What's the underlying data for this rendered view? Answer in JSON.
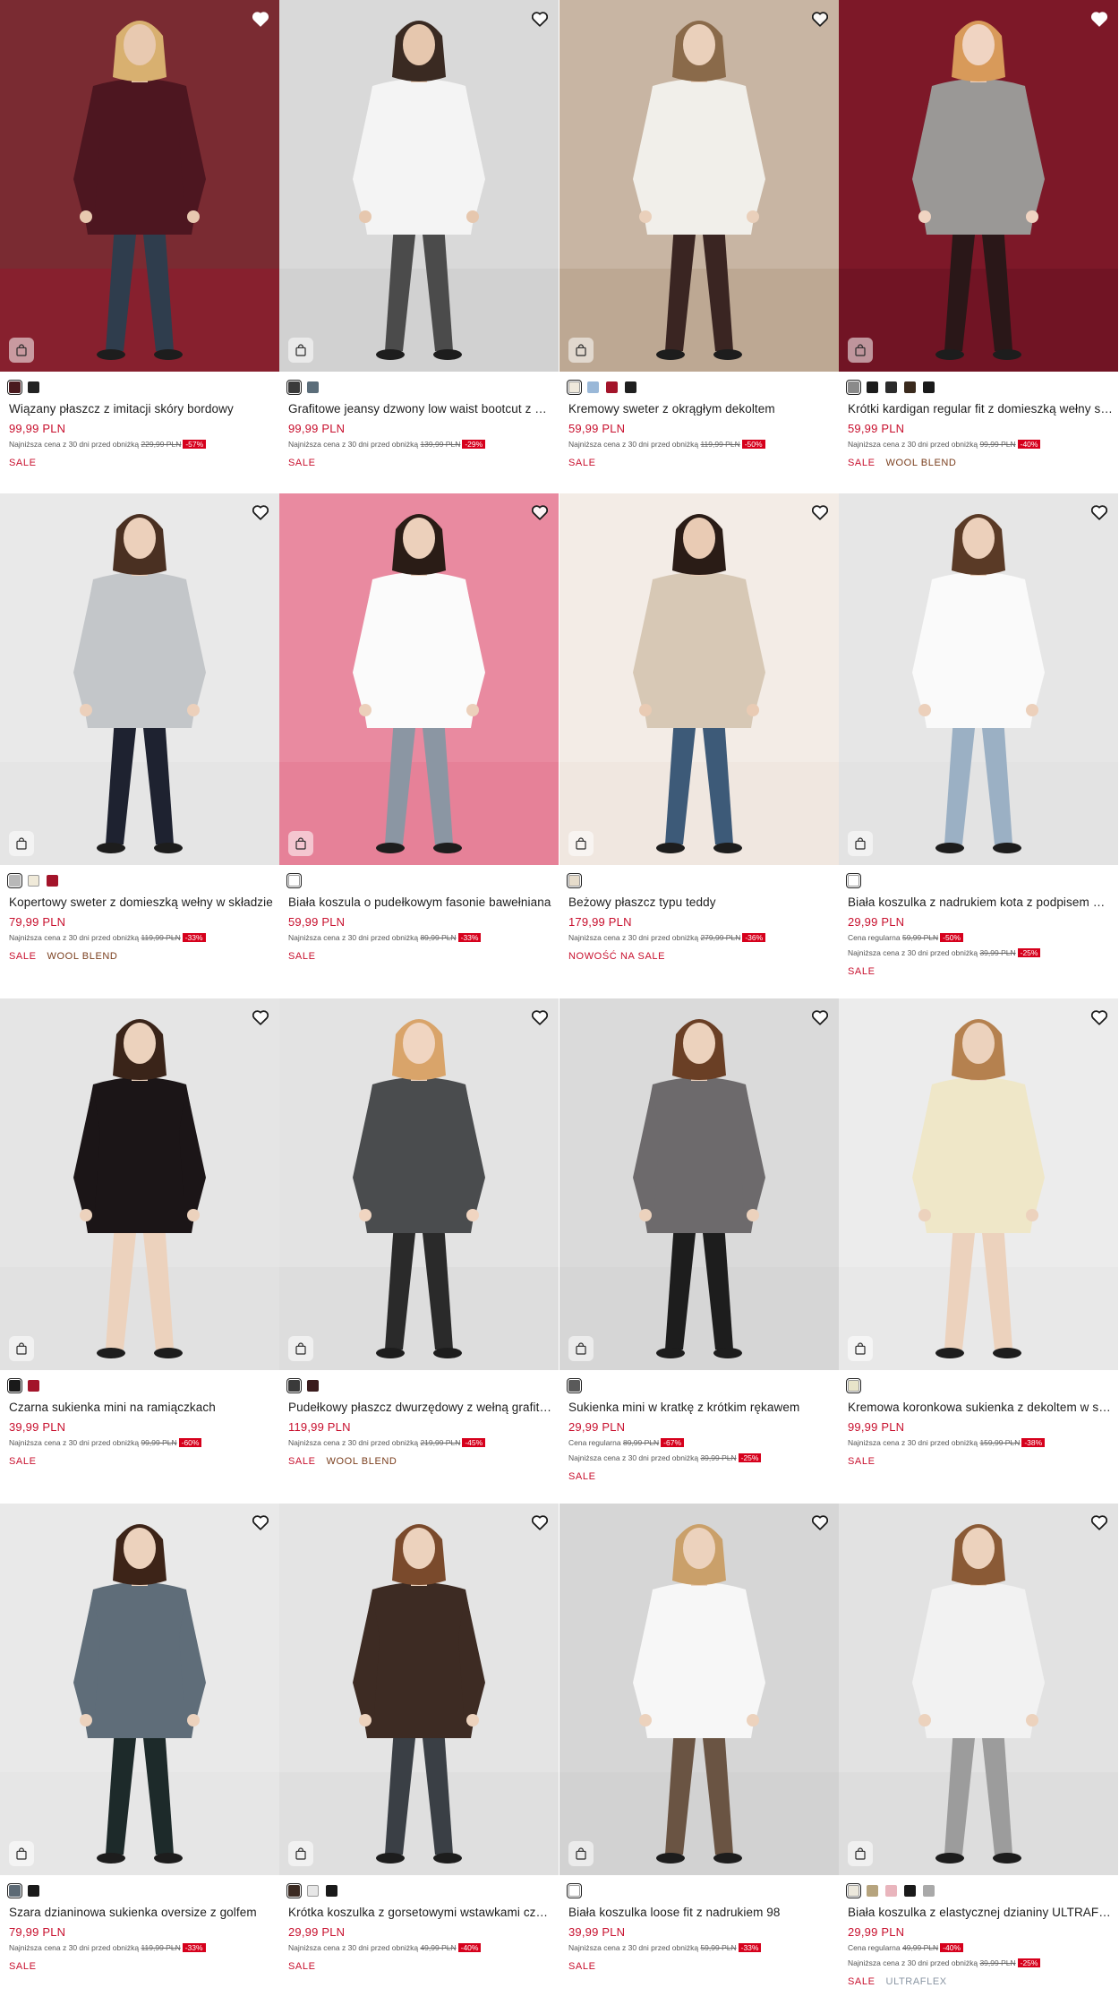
{
  "colors": {
    "price": "#c8102e",
    "discount_badge": "#d6001c",
    "tag_secondary": "#7a3e1d"
  },
  "icons": {
    "favorite": "heart-icon",
    "add_to_bag": "shopping-bag-icon"
  },
  "products": [
    {
      "title": "Wiązany płaszcz z imitacji skóry bordowy",
      "price": "99,99 PLN",
      "lines": [
        {
          "text": "Najniższa cena z 30 dni przed obniżką",
          "old": "229,99 PLN",
          "disc": "-57%"
        }
      ],
      "tags": [
        "SALE"
      ],
      "swatches": [
        "#4a1a1e",
        "#222222"
      ],
      "selected": 0,
      "heart_filled": true,
      "scene": {
        "bg1": "#7a2b32",
        "bg2": "#a14a53",
        "floor": "#8a1f2e",
        "garment": "#4d1620",
        "skin": "#e8c9b0",
        "hair": "#d8b070",
        "legs": "#2f3d4d"
      }
    },
    {
      "title": "Grafitowe jeansy dzwony low waist bootcut z wysokim stanem",
      "price": "99,99 PLN",
      "lines": [
        {
          "text": "Najniższa cena z 30 dni przed obniżką",
          "old": "139,99 PLN",
          "disc": "-29%"
        }
      ],
      "tags": [
        "SALE"
      ],
      "swatches": [
        "#3a3a3a",
        "#5b6d7a"
      ],
      "selected": 0,
      "heart_filled": false,
      "scene": {
        "bg1": "#d9d9d9",
        "bg2": "#c9c9c9",
        "floor": "#cfcfcf",
        "garment": "#f4f4f4",
        "skin": "#e6c7ae",
        "hair": "#3a2a22",
        "legs": "#4b4b4b"
      }
    },
    {
      "title": "Kremowy sweter z okrągłym dekoltem",
      "price": "59,99 PLN",
      "lines": [
        {
          "text": "Najniższa cena z 30 dni przed obniżką",
          "old": "119,99 PLN",
          "disc": "-50%"
        }
      ],
      "tags": [
        "SALE"
      ],
      "swatches": [
        "#efe9dc",
        "#9ab8d8",
        "#a3142a",
        "#1f1f1f"
      ],
      "selected": 0,
      "heart_filled": false,
      "scene": {
        "bg1": "#c8b5a3",
        "bg2": "#b39d89",
        "floor": "#bba690",
        "garment": "#f1efea",
        "skin": "#ead0bb",
        "hair": "#8a6a4a",
        "legs": "#3a2522"
      }
    },
    {
      "title": "Krótki kardigan regular fit z domieszką wełny szary",
      "price": "59,99 PLN",
      "lines": [
        {
          "text": "Najniższa cena z 30 dni przed obniżką",
          "old": "99,99 PLN",
          "disc": "-40%"
        }
      ],
      "tags": [
        "SALE",
        "WOOL BLEND"
      ],
      "swatches": [
        "#8a8a8a",
        "#1c1c1c",
        "#2b2b2b",
        "#3a2a1d",
        "#1a1a1a"
      ],
      "selected": 0,
      "heart_filled": true,
      "scene": {
        "bg1": "#7d1828",
        "bg2": "#8f2233",
        "floor": "#6e1423",
        "garment": "#9a9896",
        "skin": "#f0d4c2",
        "hair": "#d89a5a",
        "legs": "#2a1718"
      }
    },
    {
      "title": "Kopertowy sweter z domieszką wełny w składzie",
      "price": "79,99 PLN",
      "lines": [
        {
          "text": "Najniższa cena z 30 dni przed obniżką",
          "old": "119,99 PLN",
          "disc": "-33%"
        }
      ],
      "tags": [
        "SALE",
        "WOOL BLEND"
      ],
      "swatches": [
        "#b8b8b8",
        "#f0ead9",
        "#a3142a"
      ],
      "selected": 0,
      "heart_filled": false,
      "scene": {
        "bg1": "#e9e9e9",
        "bg2": "#dedede",
        "floor": "#e4e4e4",
        "garment": "#c3c6c9",
        "skin": "#ecd0bb",
        "hair": "#4a3022",
        "legs": "#1e2230"
      }
    },
    {
      "title": "Biała koszula o pudełkowym fasonie bawełniana",
      "price": "59,99 PLN",
      "lines": [
        {
          "text": "Najniższa cena z 30 dni przed obniżką",
          "old": "89,99 PLN",
          "disc": "-33%"
        }
      ],
      "tags": [
        "SALE"
      ],
      "swatches": [
        "#ffffff"
      ],
      "selected": 0,
      "heart_filled": false,
      "scene": {
        "bg1": "#e98aa0",
        "bg2": "#dc6f89",
        "floor": "#e57f97",
        "garment": "#fbfbfb",
        "skin": "#ecd0bb",
        "hair": "#2a1c16",
        "legs": "#8b96a3"
      }
    },
    {
      "title": "Beżowy płaszcz typu teddy",
      "price": "179,99 PLN",
      "lines": [
        {
          "text": "Najniższa cena z 30 dni przed obniżką",
          "old": "279,99 PLN",
          "disc": "-36%"
        }
      ],
      "tags": [
        "NOWOŚĆ NA SALE"
      ],
      "swatches": [
        "#e6dccb"
      ],
      "selected": 0,
      "heart_filled": false,
      "scene": {
        "bg1": "#f3ece6",
        "bg2": "#ebe2da",
        "floor": "#efe6de",
        "garment": "#d7c8b5",
        "skin": "#e9cbb4",
        "hair": "#2a1c16",
        "legs": "#3d5a78"
      }
    },
    {
      "title": "Biała koszulka z nadrukiem kota z podpisem Purr-Fection",
      "price": "29,99 PLN",
      "lines": [
        {
          "text": "Cena regularna",
          "old": "59,99 PLN",
          "disc": "-50%"
        },
        {
          "text": "Najniższa cena z 30 dni przed obniżką",
          "old": "39,99 PLN",
          "disc": "-25%"
        }
      ],
      "tags": [
        "SALE"
      ],
      "swatches": [
        "#ffffff"
      ],
      "selected": 0,
      "heart_filled": false,
      "scene": {
        "bg1": "#e6e6e6",
        "bg2": "#dadada",
        "floor": "#e2e2e2",
        "garment": "#fafafa",
        "skin": "#ecd0bb",
        "hair": "#5a3a26",
        "legs": "#9bb0c4"
      }
    },
    {
      "title": "Czarna sukienka mini na ramiączkach",
      "price": "39,99 PLN",
      "lines": [
        {
          "text": "Najniższa cena z 30 dni przed obniżką",
          "old": "99,99 PLN",
          "disc": "-60%"
        }
      ],
      "tags": [
        "SALE"
      ],
      "swatches": [
        "#1a1a1a",
        "#a3142a"
      ],
      "selected": 0,
      "heart_filled": false,
      "scene": {
        "bg1": "#e5e5e5",
        "bg2": "#d9d9d9",
        "floor": "#e0e0e0",
        "garment": "#1b1517",
        "skin": "#ecd2bd",
        "hair": "#3a2419",
        "legs": "#ecd2bd"
      }
    },
    {
      "title": "Pudełkowy płaszcz dwurzędowy z wełną grafitowy",
      "price": "119,99 PLN",
      "lines": [
        {
          "text": "Najniższa cena z 30 dni przed obniżką",
          "old": "219,99 PLN",
          "disc": "-45%"
        }
      ],
      "tags": [
        "SALE",
        "WOOL BLEND"
      ],
      "swatches": [
        "#3a3a3a",
        "#3a1b1d"
      ],
      "selected": 0,
      "heart_filled": false,
      "scene": {
        "bg1": "#e3e3e3",
        "bg2": "#d5d5d5",
        "floor": "#dcdcdc",
        "garment": "#4a4c4e",
        "skin": "#f0d5c1",
        "hair": "#d9a46a",
        "legs": "#2a2a2a"
      }
    },
    {
      "title": "Sukienka mini w kratkę z krótkim rękawem",
      "price": "29,99 PLN",
      "lines": [
        {
          "text": "Cena regularna",
          "old": "89,99 PLN",
          "disc": "-67%"
        },
        {
          "text": "Najniższa cena z 30 dni przed obniżką",
          "old": "39,99 PLN",
          "disc": "-25%"
        }
      ],
      "tags": [
        "SALE"
      ],
      "swatches": [
        "#5a5a5a"
      ],
      "selected": 0,
      "heart_filled": false,
      "scene": {
        "bg1": "#dadada",
        "bg2": "#cecece",
        "floor": "#d5d5d5",
        "garment": "#6d6a6c",
        "skin": "#ecd2bd",
        "hair": "#6a3f25",
        "legs": "#1d1d1d"
      }
    },
    {
      "title": "Kremowa koronkowa sukienka z dekoltem w serek",
      "price": "99,99 PLN",
      "lines": [
        {
          "text": "Najniższa cena z 30 dni przed obniżką",
          "old": "159,99 PLN",
          "disc": "-38%"
        }
      ],
      "tags": [
        "SALE"
      ],
      "swatches": [
        "#e8e4c9"
      ],
      "selected": 0,
      "heart_filled": false,
      "scene": {
        "bg1": "#ececec",
        "bg2": "#e1e1e1",
        "floor": "#e7e7e7",
        "garment": "#efe7c8",
        "skin": "#ecd2bd",
        "hair": "#b5814f",
        "legs": "#ecd2bd"
      }
    },
    {
      "title": "Szara dzianinowa sukienka oversize z golfem",
      "price": "79,99 PLN",
      "lines": [
        {
          "text": "Najniższa cena z 30 dni przed obniżką",
          "old": "119,99 PLN",
          "disc": "-33%"
        }
      ],
      "tags": [
        "SALE"
      ],
      "swatches": [
        "#5d6a75",
        "#1a1a1a"
      ],
      "selected": 0,
      "heart_filled": false,
      "scene": {
        "bg1": "#e9e9e9",
        "bg2": "#dedede",
        "floor": "#e5e5e5",
        "garment": "#5f6d79",
        "skin": "#ecd2bd",
        "hair": "#3d2418",
        "legs": "#1d2a2a"
      }
    },
    {
      "title": "Krótka koszulka z gorsetowymi wstawkami czekoladowa",
      "price": "29,99 PLN",
      "lines": [
        {
          "text": "Najniższa cena z 30 dni przed obniżką",
          "old": "49,99 PLN",
          "disc": "-40%"
        }
      ],
      "tags": [
        "SALE"
      ],
      "swatches": [
        "#3b2a22",
        "#e7e7e7",
        "#1a1a1a"
      ],
      "selected": 0,
      "heart_filled": false,
      "scene": {
        "bg1": "#e4e4e4",
        "bg2": "#d8d8d8",
        "floor": "#dedede",
        "garment": "#3d2b23",
        "skin": "#ecd2bd",
        "hair": "#7a4a2c",
        "legs": "#3a3f45"
      }
    },
    {
      "title": "Biała koszulka loose fit z nadrukiem 98",
      "price": "39,99 PLN",
      "lines": [
        {
          "text": "Najniższa cena z 30 dni przed obniżką",
          "old": "59,99 PLN",
          "disc": "-33%"
        }
      ],
      "tags": [
        "SALE"
      ],
      "swatches": [
        "#ffffff"
      ],
      "selected": 0,
      "heart_filled": false,
      "scene": {
        "bg1": "#d6d6d6",
        "bg2": "#cacaca",
        "floor": "#d1d1d1",
        "garment": "#f7f7f7",
        "skin": "#ecd2bd",
        "hair": "#caa06a",
        "legs": "#6a5443"
      }
    },
    {
      "title": "Biała koszulka z elastycznej dzianiny ULTRAFLEX",
      "price": "29,99 PLN",
      "lines": [
        {
          "text": "Cena regularna",
          "old": "49,99 PLN",
          "disc": "-40%"
        },
        {
          "text": "Najniższa cena z 30 dni przed obniżką",
          "old": "39,99 PLN",
          "disc": "-25%"
        }
      ],
      "tags": [
        "SALE",
        "ULTRAFLEX"
      ],
      "swatches": [
        "#ece8dc",
        "#b6a47e",
        "#e9b5bd",
        "#1a1a1a",
        "#a9a9a9"
      ],
      "selected": 0,
      "heart_filled": false,
      "scene": {
        "bg1": "#e2e2e2",
        "bg2": "#d6d6d6",
        "floor": "#dcdcdc",
        "garment": "#f2f2f2",
        "skin": "#ecd2bd",
        "hair": "#8a5a36",
        "legs": "#9c9c9c"
      }
    }
  ]
}
